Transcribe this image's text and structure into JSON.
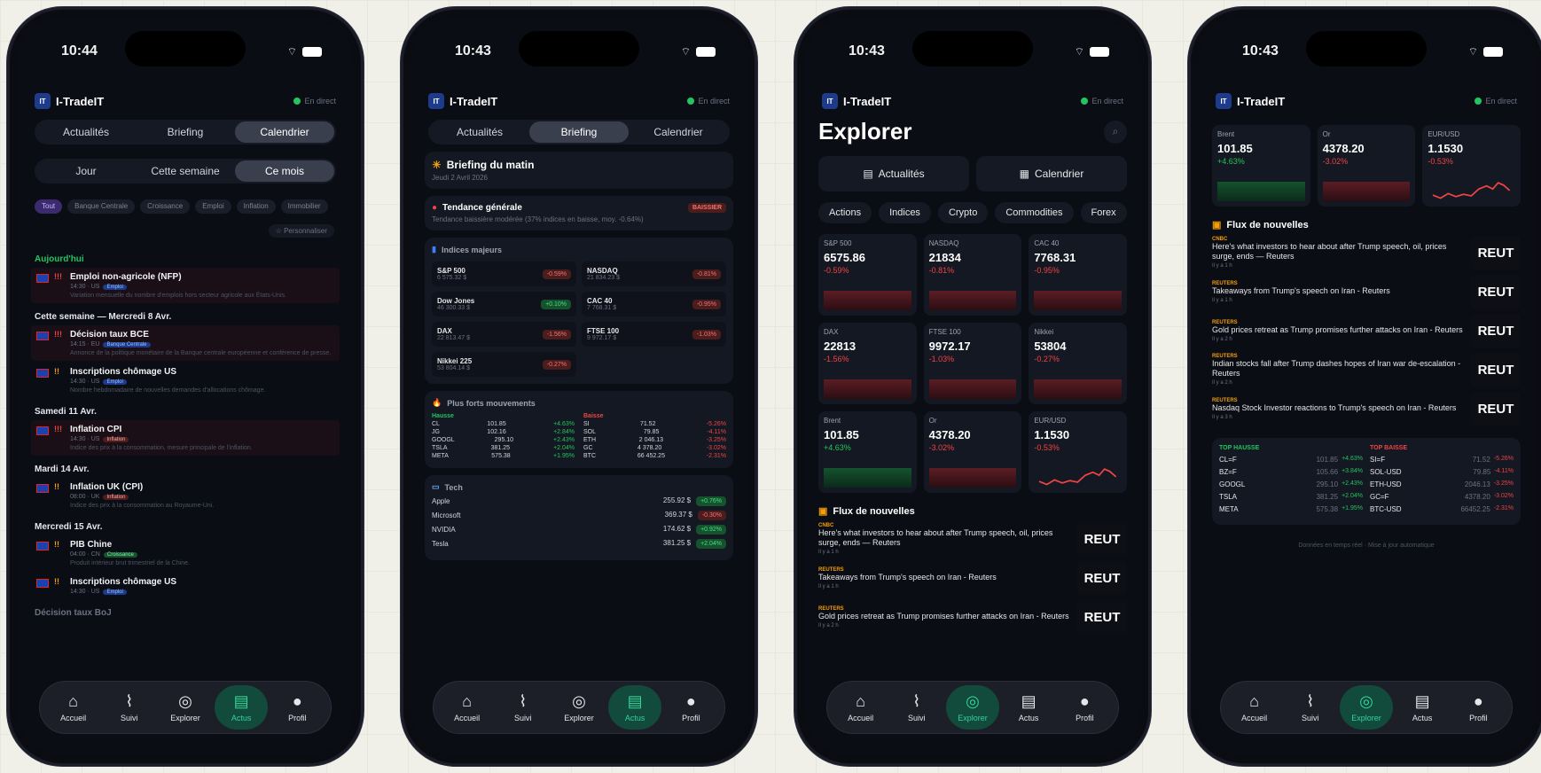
{
  "common": {
    "app_name": "I-TradeIT",
    "logo": "IT",
    "live_label": "En direct",
    "tabs": [
      "Accueil",
      "Suivi",
      "Explorer",
      "Actus",
      "Profil"
    ]
  },
  "phone1": {
    "time": "10:44",
    "segments": [
      "Actualités",
      "Briefing",
      "Calendrier"
    ],
    "active_segment": 2,
    "period": [
      "Jour",
      "Cette semaine",
      "Ce mois"
    ],
    "active_period": 2,
    "filter_chips": [
      "Tout",
      "Banque Centrale",
      "Croissance",
      "Emploi",
      "Inflation",
      "Immobilier"
    ],
    "custom_label": "☆ Personnaliser",
    "days": [
      {
        "header": "Aujourd'hui",
        "highlight": true,
        "events": [
          {
            "title": "Emploi non-agricole (NFP)",
            "sub": "14:30 · US",
            "tag": "Emploi",
            "desc": "Variation mensuelle du nombre d'emplois hors secteur agricole aux États-Unis.",
            "imp": "!!!"
          }
        ]
      },
      {
        "header": "Cette semaine — Mercredi 8 Avr.",
        "events": [
          {
            "title": "Décision taux BCE",
            "sub": "14:15 · EU",
            "tag": "Banque Centrale",
            "desc": "Annonce de la politique monétaire de la Banque centrale européenne et conférence de presse.",
            "imp": "!!!"
          },
          {
            "title": "Inscriptions chômage US",
            "sub": "14:30 · US",
            "tag": "Emploi",
            "desc": "Nombre hebdomadaire de nouvelles demandes d'allocations chômage.",
            "imp": "!!"
          }
        ]
      },
      {
        "header": "Samedi 11 Avr.",
        "events": [
          {
            "title": "Inflation CPI",
            "sub": "14:30 · US",
            "tag": "Inflation",
            "desc": "Indice des prix à la consommation, mesure principale de l'inflation.",
            "imp": "!!!",
            "red": true
          }
        ]
      },
      {
        "header": "Mardi 14 Avr.",
        "events": [
          {
            "title": "Inflation UK (CPI)",
            "sub": "08:00 · UK",
            "tag": "Inflation",
            "desc": "Indice des prix à la consommation au Royaume-Uni.",
            "imp": "!!",
            "red": true
          }
        ]
      },
      {
        "header": "Mercredi 15 Avr.",
        "events": [
          {
            "title": "PIB Chine",
            "sub": "04:00 · CN",
            "tag": "Croissance",
            "desc": "Produit intérieur brut trimestriel de la Chine.",
            "imp": "!!",
            "green": true
          },
          {
            "title": "Inscriptions chômage US",
            "sub": "14:30 · US",
            "tag": "Emploi",
            "desc": "",
            "imp": "!!"
          }
        ]
      }
    ],
    "peek": "Décision taux BoJ"
  },
  "phone2": {
    "time": "10:43",
    "segments": [
      "Actualités",
      "Briefing",
      "Calendrier"
    ],
    "active_segment": 1,
    "briefing_title": "Briefing du matin",
    "briefing_date": "Jeudi 2 Avril 2026",
    "trend_title": "Tendance générale",
    "trend_badge": "BAISSIER",
    "trend_text": "Tendance baissière modérée (37% indices en baisse, moy. -0.64%)",
    "indices_title": "Indices majeurs",
    "indices": [
      {
        "name": "S&P 500",
        "val": "6 575.32 $",
        "chg": "-0.59%",
        "up": false
      },
      {
        "name": "NASDAQ",
        "val": "21 834.23 $",
        "chg": "-0.81%",
        "up": false
      },
      {
        "name": "Dow Jones",
        "val": "46 300.33 $",
        "chg": "+0.10%",
        "up": true
      },
      {
        "name": "CAC 40",
        "val": "7 768.31 $",
        "chg": "-0.95%",
        "up": false
      },
      {
        "name": "DAX",
        "val": "22 813.47 $",
        "chg": "-1.56%",
        "up": false
      },
      {
        "name": "FTSE 100",
        "val": "9 972.17 $",
        "chg": "-1.03%",
        "up": false
      },
      {
        "name": "Nikkei 225",
        "val": "53 804.14 $",
        "chg": "-0.27%",
        "up": false
      }
    ],
    "movers_title": "Plus forts mouvements",
    "hausse_label": "Hausse",
    "baisse_label": "Baisse",
    "hausse": [
      {
        "sym": "CL",
        "val": "101.85",
        "chg": "+4.63%"
      },
      {
        "sym": "JG",
        "val": "102.16",
        "chg": "+2.84%"
      },
      {
        "sym": "GOOGL",
        "val": "295.10",
        "chg": "+2.43%"
      },
      {
        "sym": "TSLA",
        "val": "381.25",
        "chg": "+2.04%"
      },
      {
        "sym": "META",
        "val": "575.38",
        "chg": "+1.95%"
      }
    ],
    "baisse": [
      {
        "sym": "SI",
        "val": "71.52",
        "chg": "-5.26%"
      },
      {
        "sym": "SOL",
        "val": "79.85",
        "chg": "-4.11%"
      },
      {
        "sym": "ETH",
        "val": "2 046.13",
        "chg": "-3.25%"
      },
      {
        "sym": "GC",
        "val": "4 378.20",
        "chg": "-3.02%"
      },
      {
        "sym": "BTC",
        "val": "66 452.25",
        "chg": "-2.31%"
      }
    ],
    "tech_title": "Tech",
    "tech": [
      {
        "name": "Apple",
        "val": "255.92 $",
        "chg": "+0.76%"
      },
      {
        "name": "Microsoft",
        "val": "369.37 $",
        "chg": "-0.30%"
      },
      {
        "name": "NVIDIA",
        "val": "174.62 $",
        "chg": "+0.92%"
      },
      {
        "name": "Tesla",
        "val": "381.25 $",
        "chg": "+2.04%"
      }
    ]
  },
  "phone3": {
    "time": "10:43",
    "title": "Explorer",
    "buttons": [
      "Actualités",
      "Calendrier"
    ],
    "pills": [
      "Actions",
      "Indices",
      "Crypto",
      "Commodities",
      "Forex"
    ],
    "tiles": [
      {
        "name": "S&P 500",
        "val": "6575.86",
        "chg": "-0.59%",
        "up": false
      },
      {
        "name": "NASDAQ",
        "val": "21834",
        "chg": "-0.81%",
        "up": false
      },
      {
        "name": "CAC 40",
        "val": "7768.31",
        "chg": "-0.95%",
        "up": false
      },
      {
        "name": "DAX",
        "val": "22813",
        "chg": "-1.56%",
        "up": false
      },
      {
        "name": "FTSE 100",
        "val": "9972.17",
        "chg": "-1.03%",
        "up": false
      },
      {
        "name": "Nikkei",
        "val": "53804",
        "chg": "-0.27%",
        "up": false
      },
      {
        "name": "Brent",
        "val": "101.85",
        "chg": "+4.63%",
        "up": true
      },
      {
        "name": "Or",
        "val": "4378.20",
        "chg": "-3.02%",
        "up": false
      },
      {
        "name": "EUR/USD",
        "val": "1.1530",
        "chg": "-0.53%",
        "up": false,
        "spark": true
      }
    ],
    "news_title": "Flux de nouvelles",
    "news": [
      {
        "src": "CNBC",
        "hl": "Here's what investors to hear about after Trump speech, oil, prices surge, ends — Reuters",
        "ago": "Il y a 1 h"
      },
      {
        "src": "REUTERS",
        "hl": "Takeaways from Trump's speech on Iran - Reuters",
        "ago": "Il y a 1 h"
      },
      {
        "src": "REUTERS",
        "hl": "Gold prices retreat as Trump promises further attacks on Iran - Reuters",
        "ago": "Il y a 2 h"
      }
    ],
    "thumb": "REUT"
  },
  "phone4": {
    "time": "10:43",
    "tiles": [
      {
        "name": "Brent",
        "val": "101.85",
        "chg": "+4.63%",
        "up": true
      },
      {
        "name": "Or",
        "val": "4378.20",
        "chg": "-3.02%",
        "up": false
      },
      {
        "name": "EUR/USD",
        "val": "1.1530",
        "chg": "-0.53%",
        "up": false,
        "spark": true
      }
    ],
    "news_title": "Flux de nouvelles",
    "news": [
      {
        "src": "CNBC",
        "hl": "Here's what investors to hear about after Trump speech, oil, prices surge, ends — Reuters",
        "ago": "Il y a 1 h"
      },
      {
        "src": "REUTERS",
        "hl": "Takeaways from Trump's speech on Iran - Reuters",
        "ago": "Il y a 1 h"
      },
      {
        "src": "REUTERS",
        "hl": "Gold prices retreat as Trump promises further attacks on Iran - Reuters",
        "ago": "Il y a 2 h"
      },
      {
        "src": "REUTERS",
        "hl": "Indian stocks fall after Trump dashes hopes of Iran war de-escalation - Reuters",
        "ago": "Il y a 2 h"
      },
      {
        "src": "REUTERS",
        "hl": "Nasdaq Stock Investor reactions to Trump's speech on Iran - Reuters",
        "ago": "Il y a 3 h"
      }
    ],
    "thumb": "REUT",
    "top_hausse_label": "TOP HAUSSE",
    "top_baisse_label": "TOP BAISSE",
    "top_hausse": [
      {
        "sym": "CL=F",
        "val": "101.85",
        "chg": "+4.63%"
      },
      {
        "sym": "BZ=F",
        "val": "105.66",
        "chg": "+3.84%"
      },
      {
        "sym": "GOOGL",
        "val": "295.10",
        "chg": "+2.43%"
      },
      {
        "sym": "TSLA",
        "val": "381.25",
        "chg": "+2.04%"
      },
      {
        "sym": "META",
        "val": "575.38",
        "chg": "+1.95%"
      }
    ],
    "top_baisse": [
      {
        "sym": "SI=F",
        "val": "71.52",
        "chg": "-5.26%"
      },
      {
        "sym": "SOL-USD",
        "val": "79.85",
        "chg": "-4.11%"
      },
      {
        "sym": "ETH-USD",
        "val": "2046.13",
        "chg": "-3.25%"
      },
      {
        "sym": "GC=F",
        "val": "4378.20",
        "chg": "-3.02%"
      },
      {
        "sym": "BTC-USD",
        "val": "66452.25",
        "chg": "-2.31%"
      }
    ],
    "footer": "Données en temps réel · Mise à jour automatique"
  }
}
